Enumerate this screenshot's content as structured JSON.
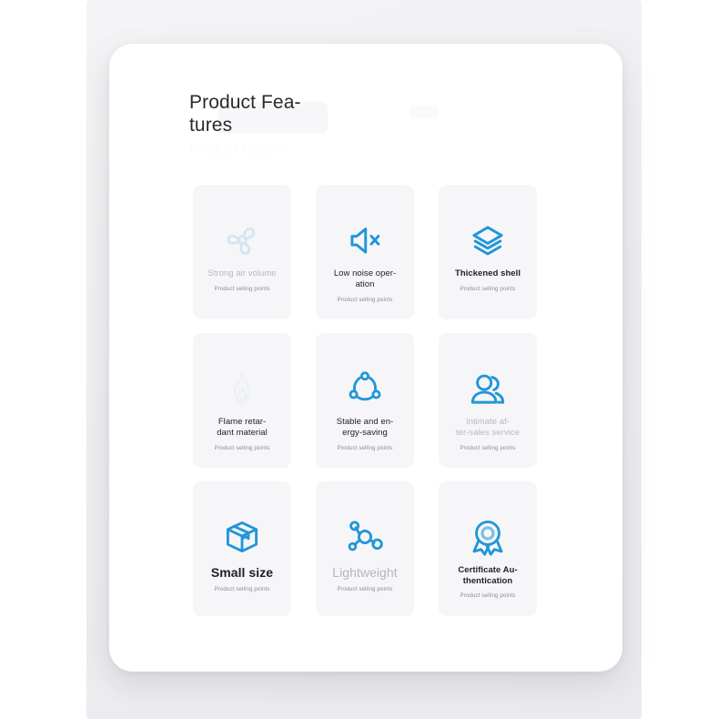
{
  "header": {
    "title": "Product Fea-\ntures",
    "subtitle": "Product feature"
  },
  "theme": {
    "accent": "#2196d9",
    "accent_light": "#7fbfe0",
    "page_bg": "#ffffff",
    "panel_bg": "#f1f1f4",
    "card_bg": "#f6f6f8",
    "text_dark": "#232327",
    "text_muted": "#8d8d93",
    "text_faded": "#b9b9bf"
  },
  "features": [
    {
      "label": "Strong air volume",
      "sub": "Product selling points",
      "icon": "fan-icon",
      "label_style": "faded-label",
      "icon_style": "icon-faded"
    },
    {
      "label": "Low noise oper-\nation",
      "sub": "Product selling points",
      "icon": "speaker-mute-icon",
      "label_style": "dark-label",
      "icon_style": ""
    },
    {
      "label": "Thickened shell",
      "sub": "Product selling points",
      "icon": "layers-icon",
      "label_style": "bold-small",
      "icon_style": ""
    },
    {
      "label": "Flame retar-\ndant material",
      "sub": "Product selling points",
      "icon": "flame-icon",
      "label_style": "dark-label",
      "icon_style": "icon-ghost"
    },
    {
      "label": "Stable and en-\nergy-saving",
      "sub": "Product selling points",
      "icon": "network-circle-icon",
      "label_style": "dark-label",
      "icon_style": ""
    },
    {
      "label": "Intimate af-\nter-sales service",
      "sub": "Product selling points",
      "icon": "people-icon",
      "label_style": "faded-label",
      "icon_style": ""
    },
    {
      "label": "Small size",
      "sub": "Product selling points",
      "icon": "box-icon",
      "label_style": "bold-label",
      "icon_style": ""
    },
    {
      "label": "Lightweight",
      "sub": "Product selling points",
      "icon": "molecule-icon",
      "label_style": "big-faded",
      "icon_style": ""
    },
    {
      "label": "Certificate Au-\nthentication",
      "sub": "Product selling points",
      "icon": "certificate-badge-icon",
      "label_style": "bold-small",
      "icon_style": ""
    }
  ]
}
